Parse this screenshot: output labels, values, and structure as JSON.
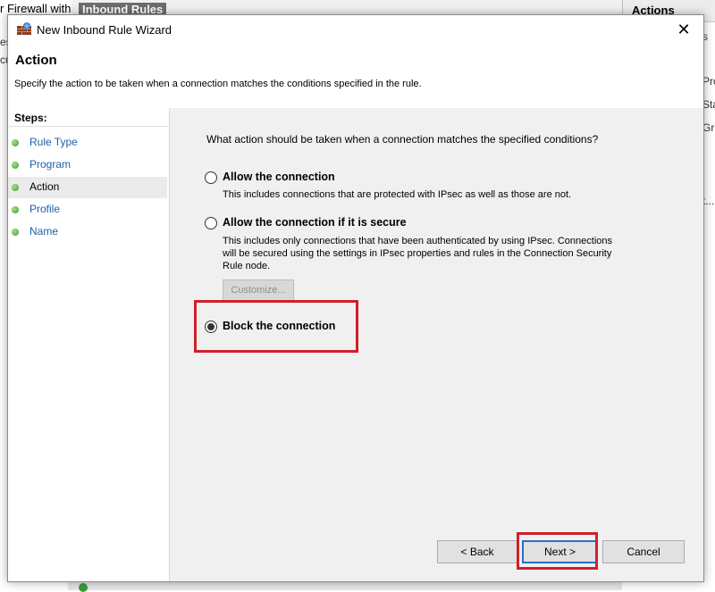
{
  "background": {
    "left_title_fragment": "r Firewall with",
    "inbound_title": "Inbound Rules",
    "actions_title": "Actions",
    "right_fragments": [
      "s",
      "Pro",
      "Sta",
      "Gro",
      "t..."
    ],
    "left_fragments": [
      "es",
      "cu"
    ]
  },
  "dialog": {
    "title": "New Inbound Rule Wizard",
    "close_glyph": "✕",
    "header": {
      "title": "Action",
      "description": "Specify the action to be taken when a connection matches the conditions specified in the rule."
    },
    "steps": {
      "label": "Steps:",
      "items": [
        {
          "label": "Rule Type"
        },
        {
          "label": "Program"
        },
        {
          "label": "Action"
        },
        {
          "label": "Profile"
        },
        {
          "label": "Name"
        }
      ],
      "current": "Action"
    },
    "content": {
      "question": "What action should be taken when a connection matches the specified conditions?",
      "options": [
        {
          "title": "Allow the connection",
          "description": "This includes connections that are protected with IPsec as well as those are not.",
          "selected": false
        },
        {
          "title": "Allow the connection if it is secure",
          "description_lines": [
            "This includes only connections that have been authenticated by using IPsec.  Connections",
            "will be secured using the settings in IPsec properties and rules in the Connection Security",
            "Rule node."
          ],
          "selected": false
        },
        {
          "title": "Block the connection",
          "selected": true
        }
      ],
      "customize_label": "Customize..."
    },
    "buttons": {
      "back": "< Back",
      "next": "Next >",
      "cancel": "Cancel"
    }
  },
  "colors": {
    "highlight": "#d0202a",
    "link_blue": "#1d5fa8",
    "bullet_green": "#3a9a28"
  }
}
